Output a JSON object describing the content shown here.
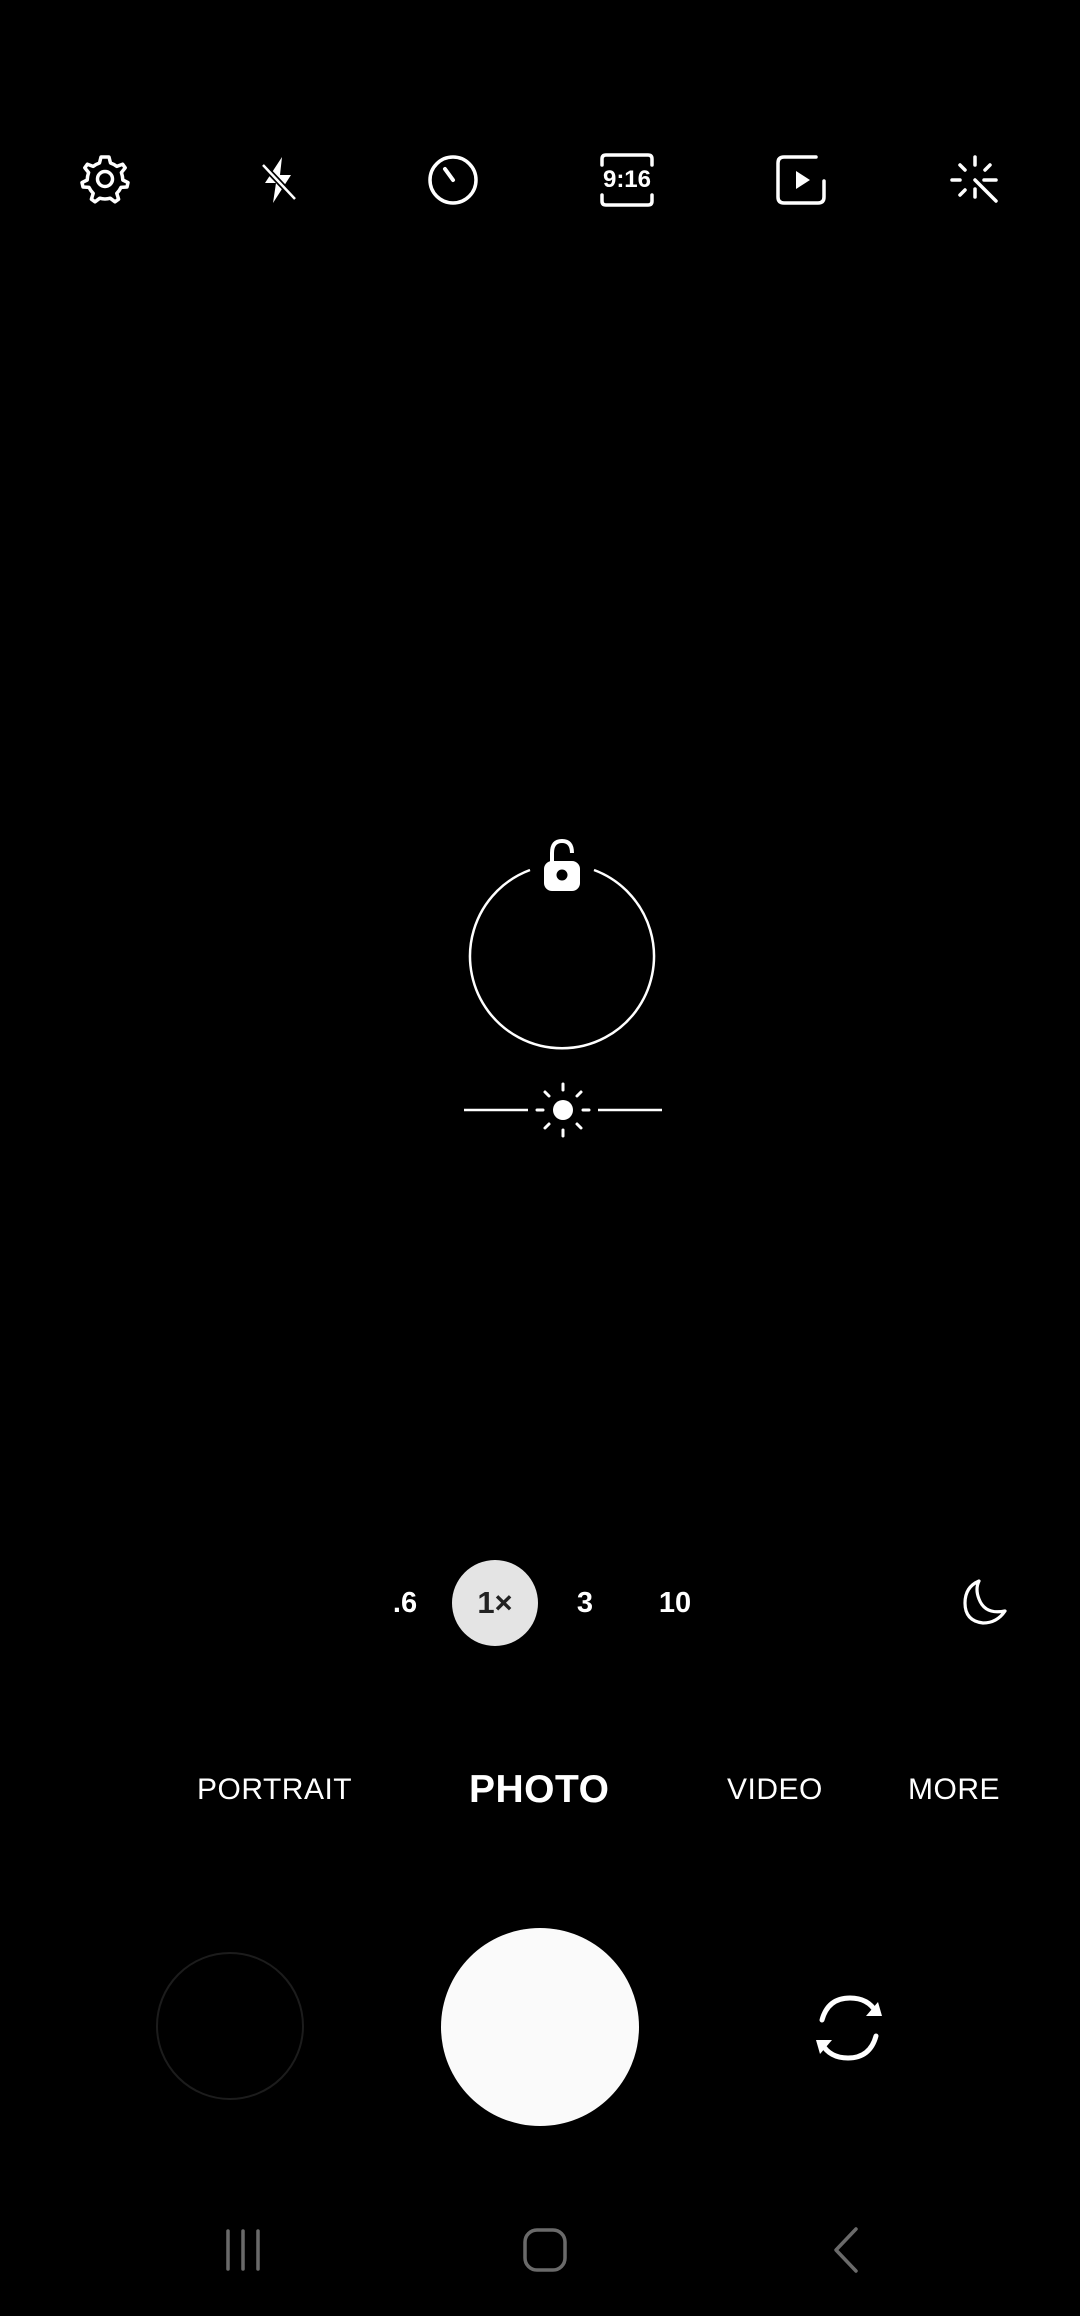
{
  "top_bar": {
    "settings_icon": "gear-icon",
    "flash_icon": "flash-off-icon",
    "timer_icon": "timer-icon",
    "aspect_ratio": "9:16",
    "motion_photo_icon": "motion-photo-icon",
    "effects_icon": "magic-wand-icon"
  },
  "viewfinder": {
    "focus_lock_icon": "unlock-icon",
    "exposure_icon": "sun-icon"
  },
  "zoom": {
    "options": [
      ".6",
      "1×",
      "3",
      "10"
    ],
    "selected": "1×",
    "night_icon": "moon-icon"
  },
  "modes": {
    "items": [
      "PORTRAIT",
      "PHOTO",
      "VIDEO",
      "MORE"
    ],
    "selected": "PHOTO"
  },
  "controls": {
    "gallery_icon": "gallery-thumbnail",
    "shutter_icon": "shutter-button",
    "switch_camera_icon": "switch-camera-icon"
  },
  "navbar": {
    "recents_icon": "recents-icon",
    "home_icon": "home-icon",
    "back_icon": "back-icon"
  },
  "colors": {
    "background": "#000000",
    "foreground": "#ffffff",
    "zoom_active_bg": "#e4e4e4",
    "shutter": "#fafafa"
  }
}
